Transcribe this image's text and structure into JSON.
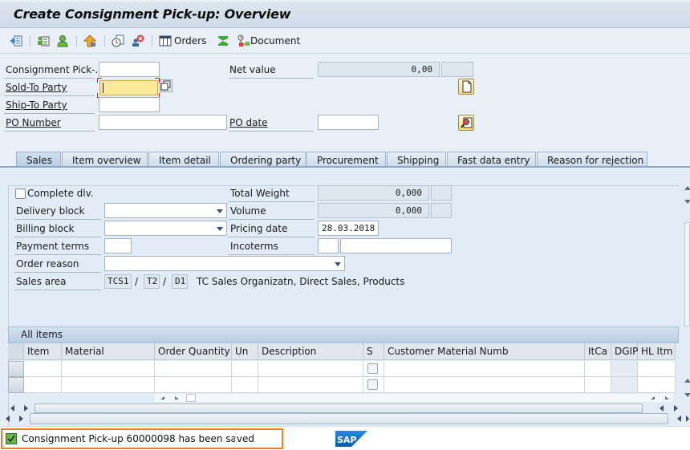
{
  "window": {
    "title": "Create Consignment Pick-up: Overview"
  },
  "toolbar": {
    "items": [
      {
        "icon": "display-doc-header-icon",
        "label": ""
      },
      {
        "icon": "header-details-icon",
        "label": ""
      },
      {
        "icon": "business-partner-icon",
        "label": ""
      },
      {
        "icon": "hierarchy-up-icon",
        "label": ""
      },
      {
        "icon": "copy-doc-icon",
        "label": ""
      },
      {
        "icon": "cancel-partner-icon",
        "label": ""
      },
      {
        "icon": "orders-grid-icon",
        "label": "Orders"
      },
      {
        "icon": "sum-sigma-icon",
        "label": ""
      },
      {
        "icon": "document-flow-icon",
        "label": "Document"
      }
    ]
  },
  "header": {
    "consignment_label": "Consignment Pick-...",
    "consignment_value": "",
    "sold_to_label": "Sold-To Party",
    "sold_to_value": "",
    "ship_to_label": "Ship-To Party",
    "ship_to_value": "",
    "po_number_label": "PO Number",
    "po_number_value": "",
    "net_value_label": "Net value",
    "net_value": "0,00",
    "net_currency": "",
    "po_date_label": "PO date",
    "po_date_value": ""
  },
  "tabs": [
    {
      "label": "Sales",
      "active": true
    },
    {
      "label": "Item overview",
      "active": false
    },
    {
      "label": "Item detail",
      "active": false
    },
    {
      "label": "Ordering party",
      "active": false
    },
    {
      "label": "Procurement",
      "active": false
    },
    {
      "label": "Shipping",
      "active": false
    },
    {
      "label": "Fast data entry",
      "active": false
    },
    {
      "label": "Reason for rejection",
      "active": false
    }
  ],
  "sales": {
    "complete_dlv_label": "Complete dlv.",
    "complete_dlv_checked": false,
    "delivery_block_label": "Delivery block",
    "delivery_block_value": "",
    "billing_block_label": "Billing block",
    "billing_block_value": "",
    "payment_terms_label": "Payment terms",
    "payment_terms_value": "",
    "order_reason_label": "Order reason",
    "order_reason_value": "",
    "sales_area_label": "Sales area",
    "sales_org": "TCS1",
    "dist_channel": "T2",
    "division": "D1",
    "sep": "/",
    "sales_area_desc": "TC Sales Organizatn, Direct Sales, Products",
    "total_weight_label": "Total Weight",
    "total_weight": "0,000",
    "weight_unit": "",
    "volume_label": "Volume",
    "volume": "0,000",
    "volume_unit": "",
    "pricing_date_label": "Pricing date",
    "pricing_date": "28.03.2018",
    "incoterms_label": "Incoterms",
    "incoterms_1": "",
    "incoterms_2": ""
  },
  "items_table": {
    "title": "All items",
    "columns": [
      "Item",
      "Material",
      "Order Quantity",
      "Un",
      "Description",
      "S",
      "Customer Material Numb",
      "ItCa",
      "DGIP",
      "HL Itm"
    ],
    "rows": [
      [
        "",
        "",
        "",
        "",
        "",
        false,
        "",
        "",
        "",
        ""
      ],
      [
        "",
        "",
        "",
        "",
        "",
        false,
        "",
        "",
        "",
        ""
      ]
    ]
  },
  "status": {
    "message": "Consignment Pick-up 60000098 has been saved",
    "type": "success"
  },
  "brand": {
    "logo_text": "SAP",
    "logo_color": "#1a6fc4"
  }
}
